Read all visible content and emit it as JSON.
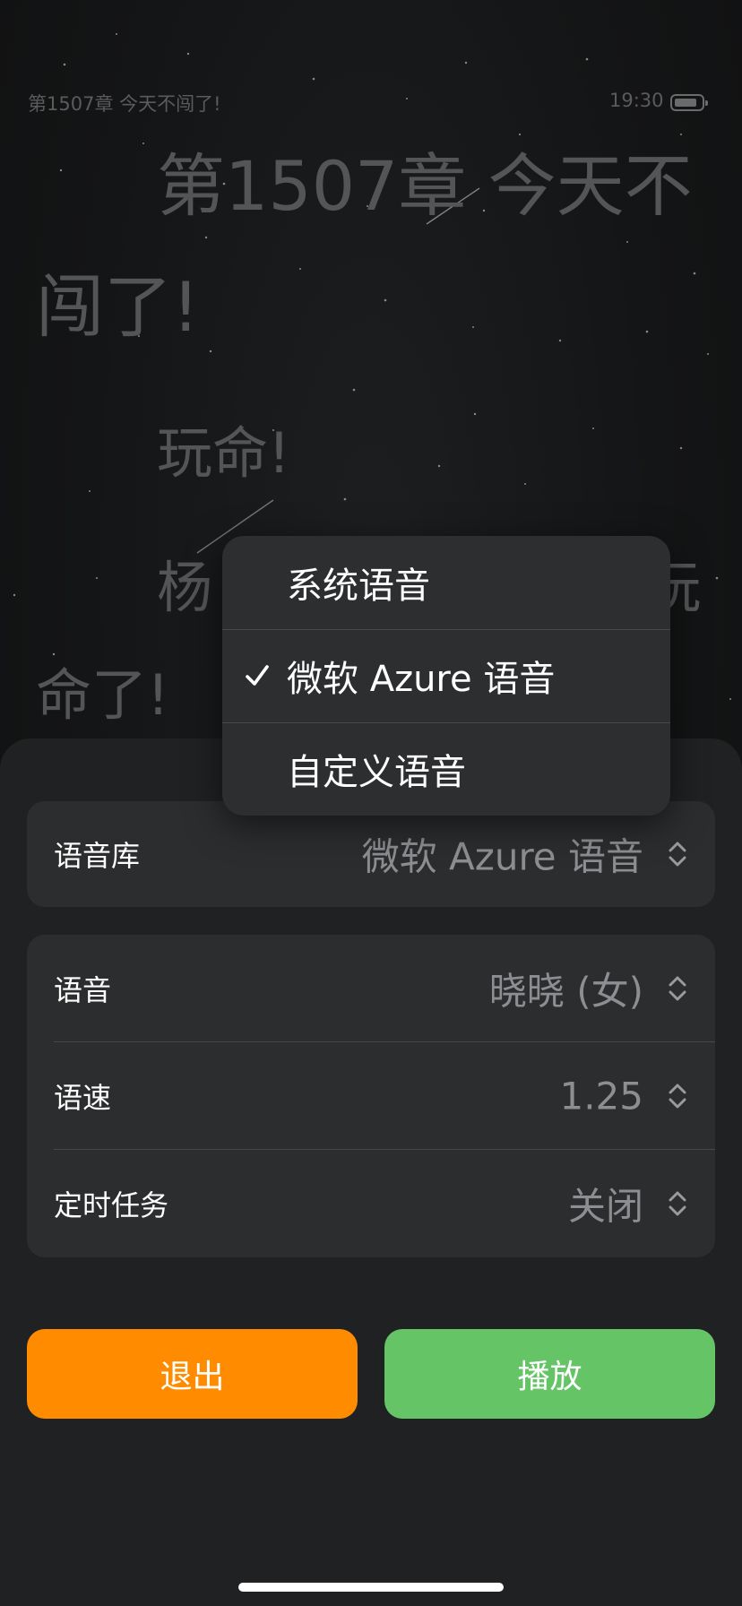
{
  "reader": {
    "chapter_header": "第1507章 今天不闯了!",
    "time": "19:30",
    "title_line1": "第1507章 今天不",
    "title_line2": "闯了!",
    "body_line1": "玩命!",
    "body_line2_start": "杨",
    "body_line2_end": "玩",
    "body_line3": "命了!"
  },
  "menu": {
    "items": [
      {
        "label": "系统语音",
        "checked": false
      },
      {
        "label": "微软 Azure 语音",
        "checked": true
      },
      {
        "label": "自定义语音",
        "checked": false
      }
    ]
  },
  "settings": {
    "library": {
      "label": "语音库",
      "value": "微软 Azure 语音"
    },
    "voice": {
      "label": "语音",
      "value": "晓晓 (女)"
    },
    "speed": {
      "label": "语速",
      "value": "1.25"
    },
    "timer": {
      "label": "定时任务",
      "value": "关闭"
    }
  },
  "buttons": {
    "exit": "退出",
    "play": "播放"
  },
  "colors": {
    "exit_button": "#ff8c00",
    "play_button": "#65c466",
    "sheet_background": "#202122",
    "card_background": "#2c2d2e"
  }
}
